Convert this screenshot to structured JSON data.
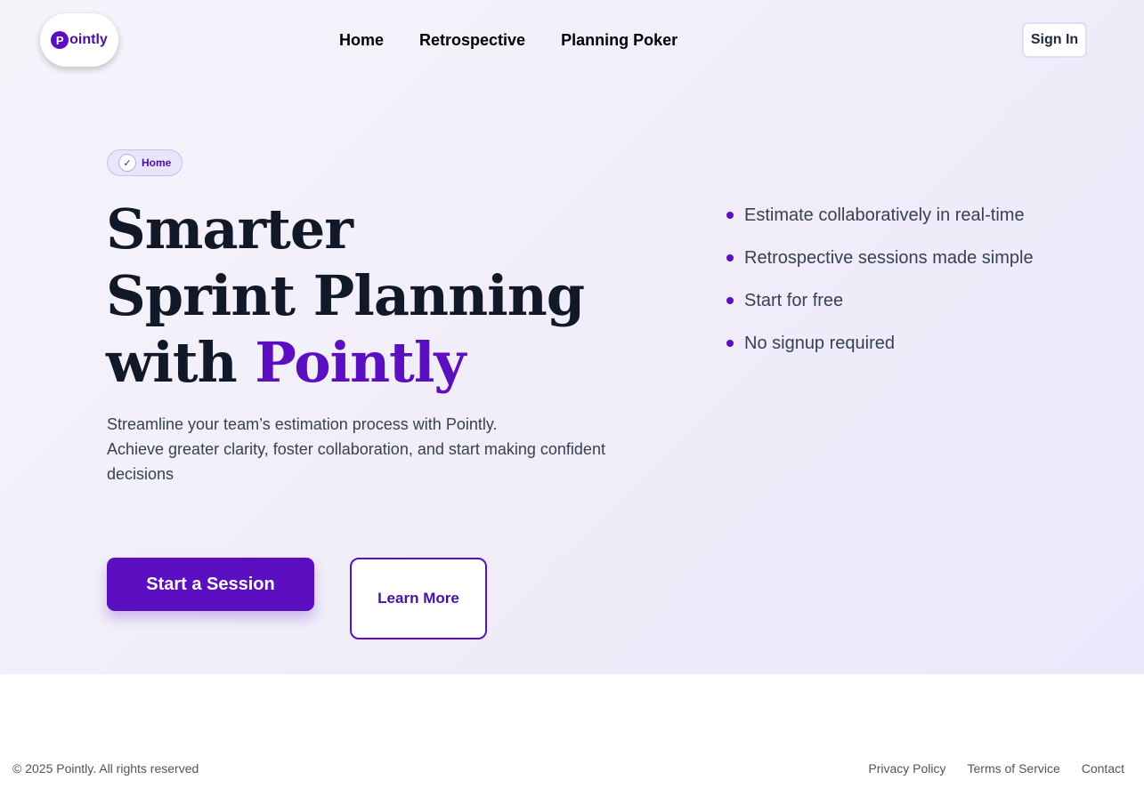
{
  "brand": {
    "logo_letter": "P",
    "logo_text": "ointly",
    "accent_color": "#5b0fc0"
  },
  "nav": {
    "items": [
      "Home",
      "Retrospective",
      "Planning Poker"
    ],
    "sign_in": "Sign In"
  },
  "hero": {
    "badge_label": "Home",
    "headline_line1": "Smarter",
    "headline_line2": "Sprint Planning",
    "headline_line3_prefix": "with ",
    "headline_line3_accent": "Pointly",
    "subtext_line1": "Streamline your team’s estimation process with Pointly.",
    "subtext_line2": "Achieve greater clarity, foster collaboration, and start making confident decisions",
    "primary_button": "Start a Session",
    "secondary_button": "Learn More"
  },
  "features": [
    "Estimate collaboratively in real-time",
    "Retrospective sessions made simple",
    "Start for free",
    "No signup required"
  ],
  "footer": {
    "copyright": "© 2025 Pointly. All rights reserved",
    "links": [
      "Privacy Policy",
      "Terms of Service",
      "Contact"
    ]
  }
}
